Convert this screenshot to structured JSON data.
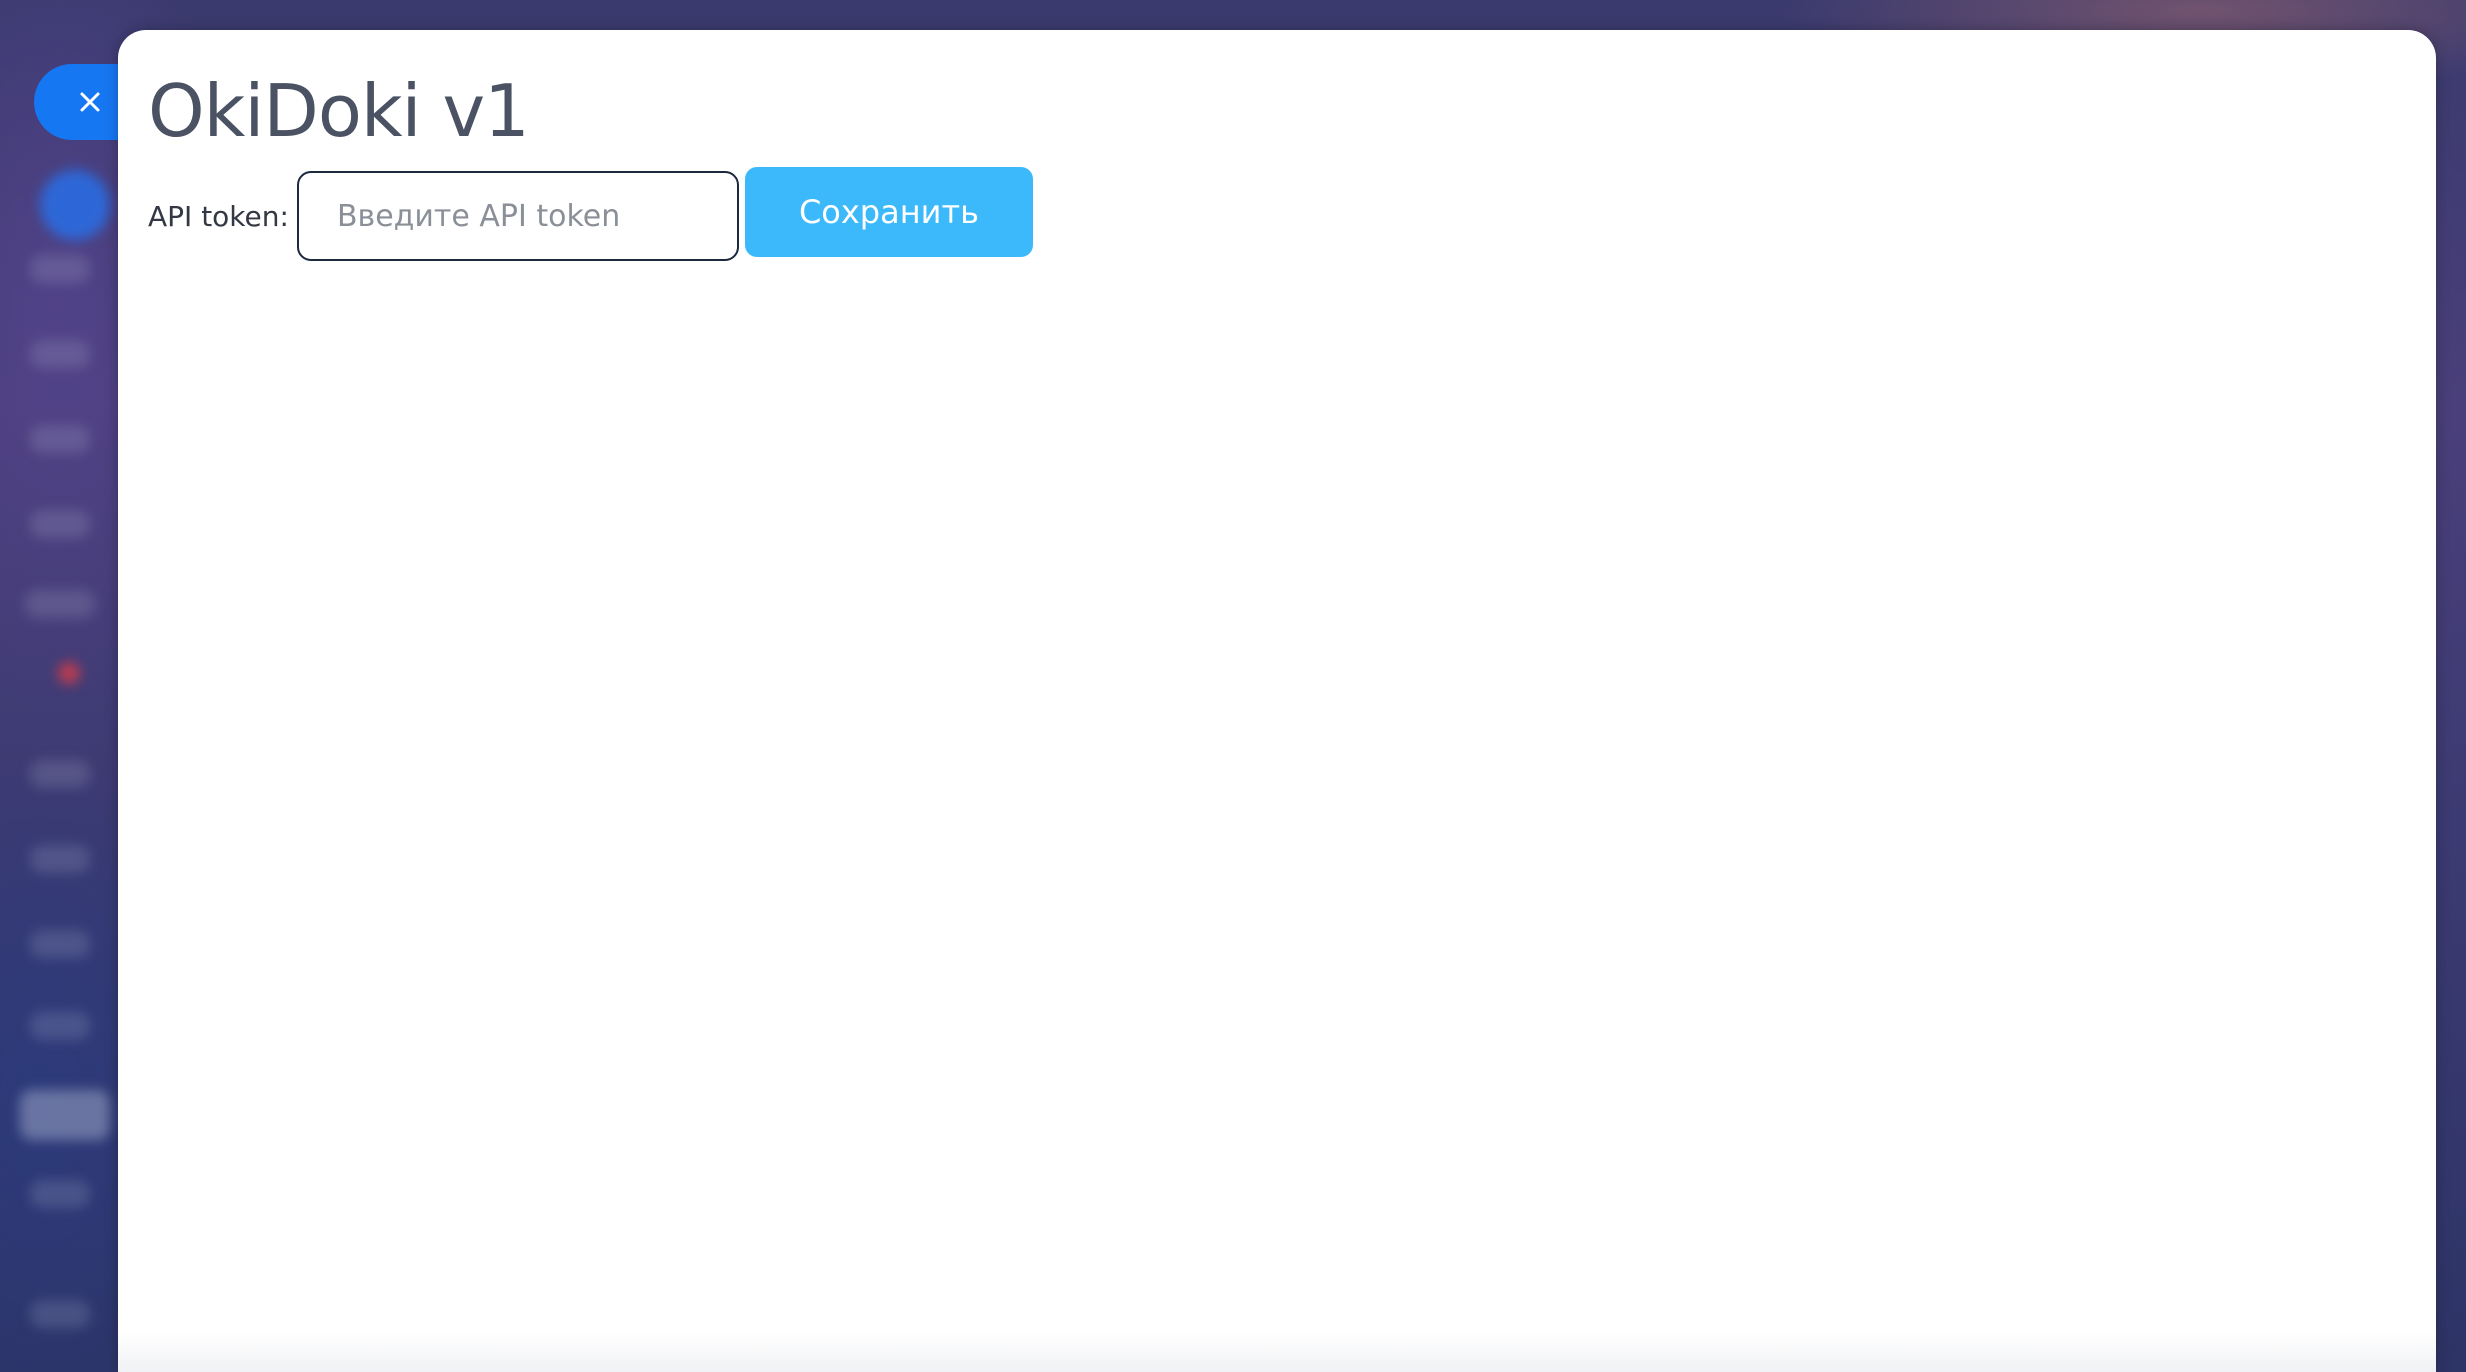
{
  "colors": {
    "close_button": "#1677f2",
    "save_button": "#3bb9fb",
    "title_text": "#4a5263",
    "input_border": "#1c2a3e"
  },
  "close_button": {
    "icon": "close-icon"
  },
  "header": {
    "title": "OkiDoki v1"
  },
  "form": {
    "token_label": "API token:",
    "token_placeholder": "Введите API token",
    "token_value": "",
    "save_label": "Сохранить"
  }
}
